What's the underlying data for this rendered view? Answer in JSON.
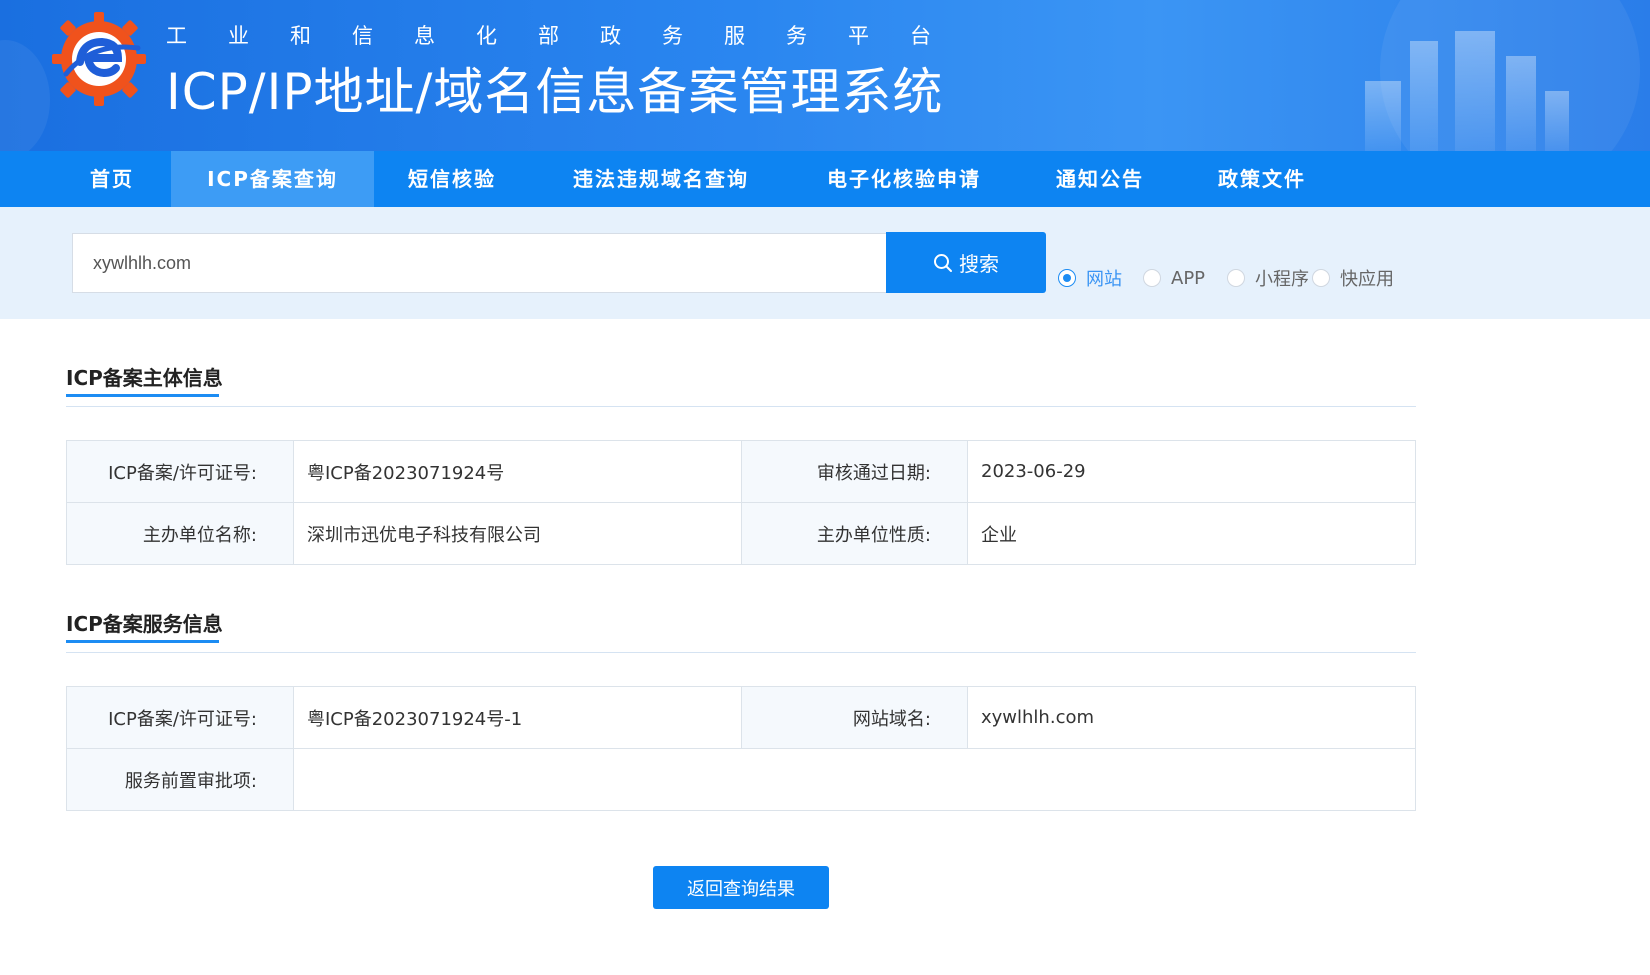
{
  "header": {
    "subtitle": "工业和信息化部政务服务平台",
    "title": "ICP/IP地址/域名信息备案管理系统"
  },
  "nav": {
    "items": [
      {
        "label": "首页"
      },
      {
        "label": "ICP备案查询"
      },
      {
        "label": "短信核验"
      },
      {
        "label": "违法违规域名查询"
      },
      {
        "label": "电子化核验申请"
      },
      {
        "label": "通知公告"
      },
      {
        "label": "政策文件"
      }
    ],
    "active_index": 1
  },
  "search": {
    "value": "xywlhlh.com",
    "button_label": "搜索",
    "types": [
      {
        "label": "网站",
        "checked": true
      },
      {
        "label": "APP",
        "checked": false
      },
      {
        "label": "小程序",
        "checked": false
      },
      {
        "label": "快应用",
        "checked": false
      }
    ]
  },
  "subject_info": {
    "title": "ICP备案主体信息",
    "rows": [
      {
        "k1": "ICP备案/许可证号:",
        "v1": "粤ICP备2023071924号",
        "k2": "审核通过日期:",
        "v2": "2023-06-29"
      },
      {
        "k1": "主办单位名称:",
        "v1": "深圳市迅优电子科技有限公司",
        "k2": "主办单位性质:",
        "v2": "企业"
      }
    ]
  },
  "service_info": {
    "title": "ICP备案服务信息",
    "rows": [
      {
        "k1": "ICP备案/许可证号:",
        "v1": "粤ICP备2023071924号-1",
        "k2": "网站域名:",
        "v2": "xywlhlh.com"
      },
      {
        "k1": "服务前置审批项:",
        "v1": ""
      }
    ]
  },
  "back_button_label": "返回查询结果",
  "colors": {
    "primary": "#0d84f2",
    "nav_active": "#3d9cf5",
    "search_bg": "#e6f1fc",
    "label_cell_bg": "#f5f9fd"
  }
}
